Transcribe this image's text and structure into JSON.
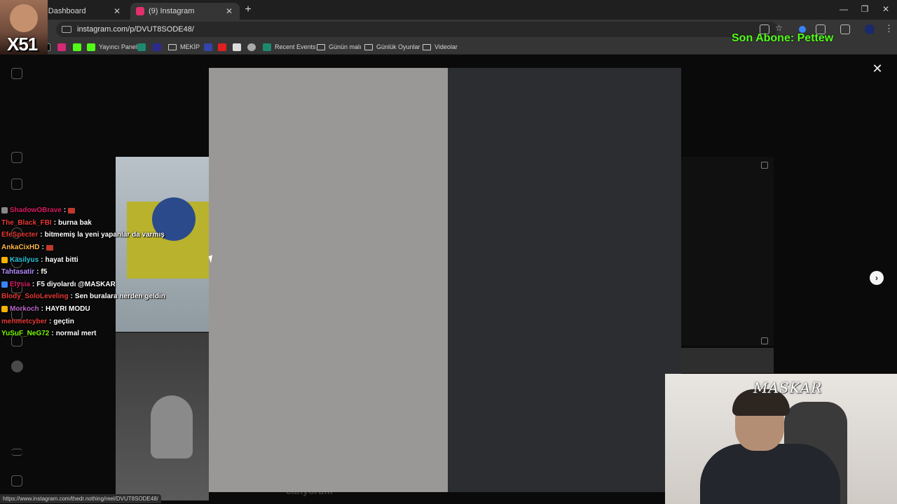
{
  "browser": {
    "tabs": [
      {
        "title": "m - Kick Dashboard",
        "color": "#53fc18"
      },
      {
        "title": "(9) Instagram",
        "color": "#e1306c"
      }
    ],
    "url": "instagram.com/p/DVUT8SODE48/",
    "bookmarks": [
      {
        "label": "",
        "icon": "x-icon",
        "color": "#000000"
      },
      {
        "label": "",
        "icon": "instagram-icon",
        "color": "#d62976"
      },
      {
        "label": "",
        "icon": "kick-icon",
        "color": "#53fc18"
      },
      {
        "label": "Yayıncı Paneli",
        "icon": "kick-icon",
        "color": "#53fc18"
      },
      {
        "label": "",
        "icon": "app-icon",
        "color": "#1d8a6e"
      },
      {
        "label": "",
        "icon": "prompt-icon",
        "color": "#2b2b8f"
      },
      {
        "label": "MEKİP",
        "icon": "folder-icon",
        "color": ""
      },
      {
        "label": "",
        "icon": "app-icon",
        "color": "#3344aa"
      },
      {
        "label": "",
        "icon": "youtube-icon",
        "color": "#e02020"
      },
      {
        "label": "",
        "icon": "app-icon",
        "color": "#dddddd"
      },
      {
        "label": "",
        "icon": "app-icon",
        "color": "#aaaaaa"
      },
      {
        "label": "Recent Events",
        "icon": "app-icon",
        "color": "#1d8a6e"
      },
      {
        "label": "Günün malı",
        "icon": "folder-icon",
        "color": ""
      },
      {
        "label": "Günlük Oyunlar",
        "icon": "folder-icon",
        "color": ""
      },
      {
        "label": "Videolar",
        "icon": "folder-icon",
        "color": ""
      }
    ]
  },
  "overlay": {
    "streamer_badge": "X51",
    "sub_alert": "Son Abone: Pettew",
    "cam_signature": "MASKAR"
  },
  "chat": [
    {
      "user": "ShadowOBrave",
      "color": "#d81b60",
      "text": "",
      "emote": true,
      "badge": "#888888"
    },
    {
      "user": "The_Black_FBI",
      "color": "#e53935",
      "text": "burna bak",
      "emote": false,
      "badge": ""
    },
    {
      "user": "EfeSpecter",
      "color": "#e53935",
      "text": "bitmemiş la yeni yapanlar da varmış",
      "emote": false,
      "badge": ""
    },
    {
      "user": "AnkaCixHD",
      "color": "#ffb74d",
      "text": "",
      "emote": true,
      "badge": ""
    },
    {
      "user": "Kasilyus",
      "color": "#26c6da",
      "text": "hayat bitti",
      "emote": false,
      "badge": "#f5b400"
    },
    {
      "user": "Tahtasatir",
      "color": "#b388ff",
      "text": "f5",
      "emote": false,
      "badge": ""
    },
    {
      "user": "Elysia",
      "color": "#d81b60",
      "text": "F5 diyolardı @MASKAR",
      "emote": false,
      "badge": "#3b82f6"
    },
    {
      "user": "Blody_SoloLeveling",
      "color": "#e53935",
      "text": "Sen buralara nerden geldin",
      "emote": false,
      "badge": ""
    },
    {
      "user": "Morkoch",
      "color": "#ba68c8",
      "text": "HAYRI MODU",
      "emote": false,
      "badge": "#f5b400"
    },
    {
      "user": "mehmetcyber",
      "color": "#e53935",
      "text": "geçtin",
      "emote": false,
      "badge": ""
    },
    {
      "user": "YuSuF_NeG72",
      "color": "#7cfc00",
      "text": "normal mert",
      "emote": false,
      "badge": ""
    }
  ],
  "page": {
    "caption_fragment": "cahyorum",
    "status_url": "https://www.instagram.com/thedr.nothing/reel/DVUT8SODE48/"
  },
  "modal": {
    "close_label": "✕",
    "next_label": "›"
  }
}
